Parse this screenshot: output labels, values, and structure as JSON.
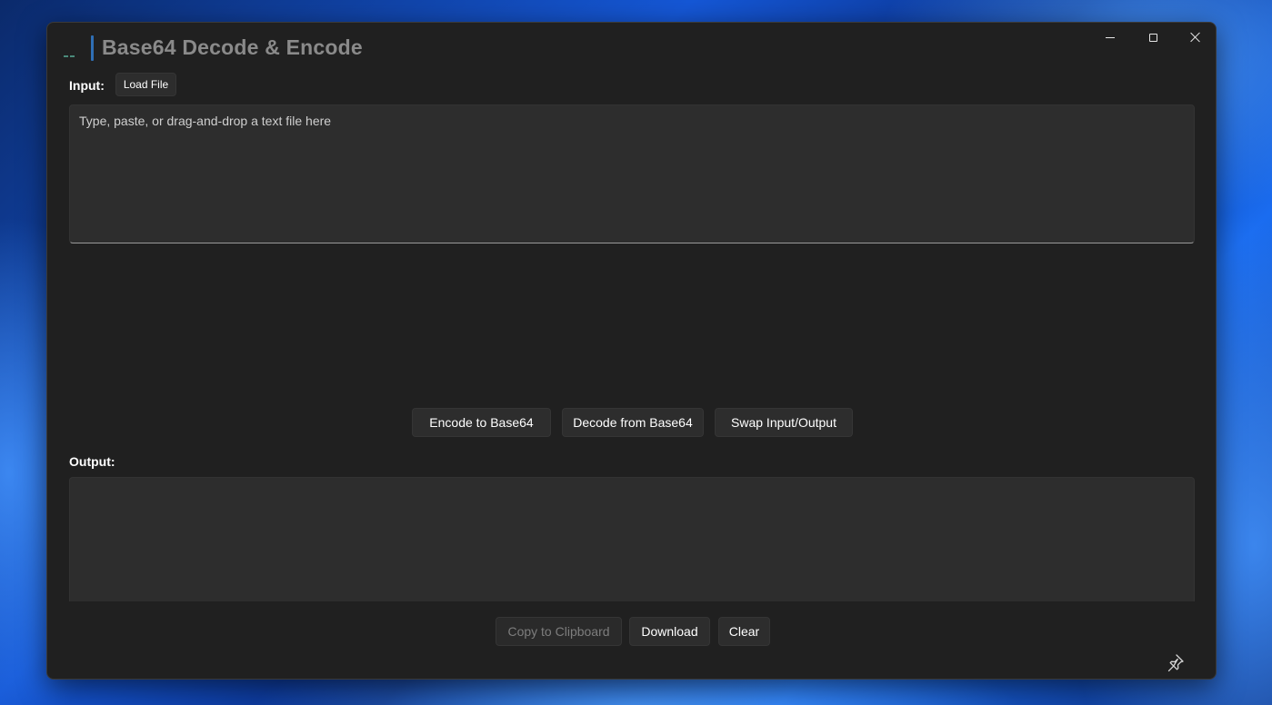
{
  "window": {
    "title": "Base64 Decode & Encode",
    "caption": {
      "minimize_icon": "minimize-icon",
      "maximize_icon": "maximize-icon",
      "close_icon": "close-icon"
    }
  },
  "input": {
    "label": "Input:",
    "load_file_label": "Load File",
    "placeholder": "Type, paste, or drag-and-drop a text file here",
    "value": ""
  },
  "actions": {
    "encode_label": "Encode to Base64",
    "decode_label": "Decode from Base64",
    "swap_label": "Swap Input/Output"
  },
  "output": {
    "label": "Output:",
    "value": "",
    "copy_label": "Copy to Clipboard",
    "download_label": "Download",
    "clear_label": "Clear"
  },
  "footer": {
    "pin_icon": "pin-icon"
  },
  "colors": {
    "window_bg": "#202020",
    "control_bg": "#2d2d2d",
    "accent": "#2f6fb5",
    "disabled_text": "#7d7d7d"
  }
}
